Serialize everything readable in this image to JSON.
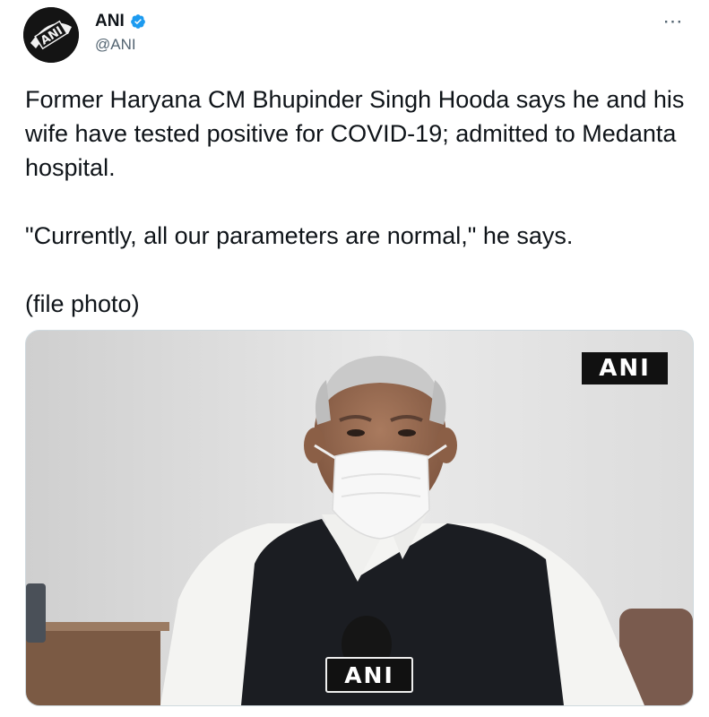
{
  "author": {
    "display_name": "ANI",
    "handle": "@ANI",
    "avatar_text": "ANI",
    "verified": true
  },
  "menu": {
    "more_icon": "⋯"
  },
  "tweet": {
    "paragraph_1": "Former Haryana CM Bhupinder Singh Hooda says he and his wife have tested positive for COVID-19; admitted to Medanta hospital.",
    "paragraph_2": "\"Currently, all our parameters are normal,\" he says.",
    "paragraph_3": "(file photo)"
  },
  "media": {
    "watermark_top": "ANI",
    "mic_label": "ANI"
  },
  "colors": {
    "verified": "#1d9bf0",
    "secondary_text": "#536471",
    "border": "#cfd9de"
  }
}
